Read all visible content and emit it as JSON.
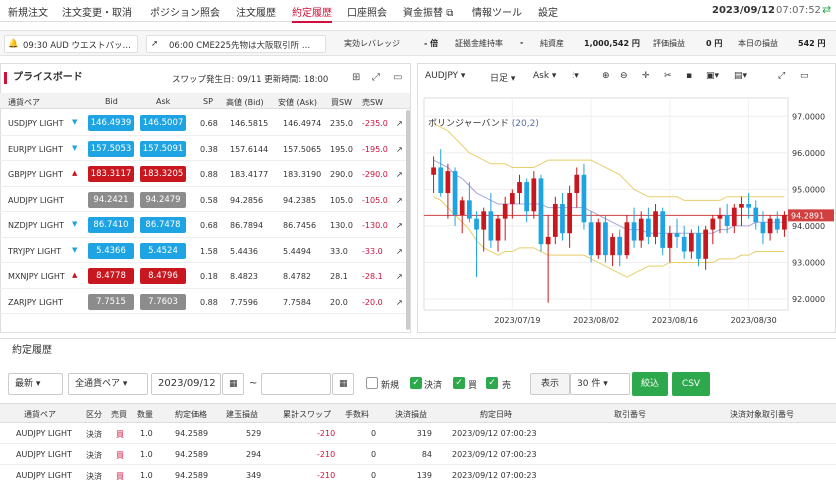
{
  "nav": {
    "items": [
      "新規注文",
      "注文変更・取消",
      "ポジション照会",
      "注文履歴",
      "約定履歴",
      "口座照会",
      "資金振替",
      "情報ツール",
      "設定"
    ],
    "active_index": 4,
    "datetime": "2023/09/12",
    "time": "07:07:52"
  },
  "news": {
    "item1": "09:30 AUD ウエストパッ…",
    "item2": "06:00 CME225先物は大阪取引所 …"
  },
  "account": {
    "leverage_label": "実効レバレッジ",
    "leverage_value": "- 倍",
    "margin_ratio_label": "証拠金維持率",
    "margin_ratio_value": "-",
    "net_assets_label": "純資産",
    "net_assets_value": "1,000,542 円",
    "valuation_label": "評価損益",
    "valuation_value": "0 円",
    "today_pl_label": "本日の損益",
    "today_pl_value": "542 円"
  },
  "priceboard": {
    "title": "プライスボード",
    "swap_info": "スワップ発生日: 09/11 更新時間: 18:00",
    "headers": [
      "通貨ペア",
      "Bid",
      "Ask",
      "SP",
      "高値 (Bid)",
      "安値 (Ask)",
      "買SW",
      "売SW"
    ],
    "rows": [
      {
        "pair": "USDJPY LIGHT",
        "dir": "down",
        "bid": "146.4939",
        "ask": "146.5007",
        "sp": "0.68",
        "high": "146.5815",
        "low": "146.4974",
        "buy_sw": "235.0",
        "sell_sw": "-235.0"
      },
      {
        "pair": "EURJPY LIGHT",
        "dir": "down",
        "bid": "157.5053",
        "ask": "157.5091",
        "sp": "0.38",
        "high": "157.6144",
        "low": "157.5065",
        "buy_sw": "195.0",
        "sell_sw": "-195.0"
      },
      {
        "pair": "GBPJPY LIGHT",
        "dir": "up",
        "bid": "183.3117",
        "ask": "183.3205",
        "sp": "0.88",
        "high": "183.4177",
        "low": "183.3190",
        "buy_sw": "290.0",
        "sell_sw": "-290.0"
      },
      {
        "pair": "AUDJPY LIGHT",
        "dir": "none",
        "bid": "94.2421",
        "ask": "94.2479",
        "sp": "0.58",
        "high": "94.2856",
        "low": "94.2385",
        "buy_sw": "105.0",
        "sell_sw": "-105.0"
      },
      {
        "pair": "NZDJPY LIGHT",
        "dir": "down",
        "bid": "86.7410",
        "ask": "86.7478",
        "sp": "0.68",
        "high": "86.7894",
        "low": "86.7456",
        "buy_sw": "130.0",
        "sell_sw": "-130.0"
      },
      {
        "pair": "TRYJPY LIGHT",
        "dir": "down",
        "bid": "5.4366",
        "ask": "5.4524",
        "sp": "1.58",
        "high": "5.4436",
        "low": "5.4494",
        "buy_sw": "33.0",
        "sell_sw": "-33.0"
      },
      {
        "pair": "MXNJPY LIGHT",
        "dir": "up",
        "bid": "8.4778",
        "ask": "8.4796",
        "sp": "0.18",
        "high": "8.4823",
        "low": "8.4782",
        "buy_sw": "28.1",
        "sell_sw": "-28.1"
      },
      {
        "pair": "ZARJPY LIGHT",
        "dir": "none",
        "bid": "7.7515",
        "ask": "7.7603",
        "sp": "0.88",
        "high": "7.7596",
        "low": "7.7584",
        "buy_sw": "20.0",
        "sell_sw": "-20.0"
      }
    ]
  },
  "chart": {
    "symbol": "AUDJPY",
    "timeframe": "日足",
    "side": "Ask",
    "indicator_label": "ボリンジャーバンド",
    "indicator_params": "(20,2)",
    "current_price_label": "94.2891",
    "colors": {
      "up": "#c8171e",
      "down": "#1ea3e3",
      "band": "#e8cf6a",
      "mid": "#a9a4d8",
      "price": "#d04040"
    }
  },
  "chart_data": {
    "type": "candlestick",
    "yaxis_ticks": [
      "97.0000",
      "96.0000",
      "95.0000",
      "94.0000",
      "93.0000",
      "92.0000"
    ],
    "ylim": [
      91.7,
      97.5
    ],
    "xaxis_ticks": [
      "2023/07/19",
      "2023/08/02",
      "2023/08/16",
      "2023/08/30"
    ],
    "candles": [
      {
        "o": 95.4,
        "h": 95.9,
        "l": 94.9,
        "c": 95.6
      },
      {
        "o": 95.6,
        "h": 96.1,
        "l": 94.8,
        "c": 94.9
      },
      {
        "o": 94.9,
        "h": 95.7,
        "l": 94.2,
        "c": 95.5
      },
      {
        "o": 95.5,
        "h": 95.6,
        "l": 94.0,
        "c": 94.3
      },
      {
        "o": 94.3,
        "h": 94.8,
        "l": 93.8,
        "c": 94.7
      },
      {
        "o": 94.7,
        "h": 95.2,
        "l": 94.1,
        "c": 94.2
      },
      {
        "o": 94.2,
        "h": 94.4,
        "l": 92.6,
        "c": 93.9
      },
      {
        "o": 93.9,
        "h": 94.5,
        "l": 93.3,
        "c": 94.4
      },
      {
        "o": 94.4,
        "h": 94.9,
        "l": 93.4,
        "c": 93.6
      },
      {
        "o": 93.6,
        "h": 94.3,
        "l": 93.3,
        "c": 94.2
      },
      {
        "o": 94.2,
        "h": 94.8,
        "l": 93.6,
        "c": 94.6
      },
      {
        "o": 94.6,
        "h": 95.0,
        "l": 94.2,
        "c": 94.9
      },
      {
        "o": 94.9,
        "h": 95.4,
        "l": 94.6,
        "c": 95.2
      },
      {
        "o": 95.2,
        "h": 95.3,
        "l": 94.1,
        "c": 94.4
      },
      {
        "o": 94.4,
        "h": 95.5,
        "l": 94.2,
        "c": 95.3
      },
      {
        "o": 95.3,
        "h": 95.4,
        "l": 93.3,
        "c": 93.5
      },
      {
        "o": 93.5,
        "h": 94.3,
        "l": 91.9,
        "c": 93.7
      },
      {
        "o": 93.7,
        "h": 94.8,
        "l": 93.5,
        "c": 94.6
      },
      {
        "o": 94.6,
        "h": 94.9,
        "l": 93.6,
        "c": 93.8
      },
      {
        "o": 93.8,
        "h": 95.1,
        "l": 93.4,
        "c": 94.9
      },
      {
        "o": 94.9,
        "h": 95.6,
        "l": 94.5,
        "c": 95.4
      },
      {
        "o": 95.4,
        "h": 95.7,
        "l": 93.9,
        "c": 94.1
      },
      {
        "o": 94.1,
        "h": 94.4,
        "l": 93.0,
        "c": 93.2
      },
      {
        "o": 93.2,
        "h": 94.2,
        "l": 93.1,
        "c": 94.1
      },
      {
        "o": 94.1,
        "h": 94.3,
        "l": 93.0,
        "c": 93.2
      },
      {
        "o": 93.2,
        "h": 93.8,
        "l": 92.9,
        "c": 93.7
      },
      {
        "o": 93.7,
        "h": 93.9,
        "l": 92.9,
        "c": 93.2
      },
      {
        "o": 93.2,
        "h": 94.3,
        "l": 93.1,
        "c": 94.1
      },
      {
        "o": 94.1,
        "h": 94.5,
        "l": 93.4,
        "c": 93.6
      },
      {
        "o": 93.6,
        "h": 94.4,
        "l": 93.4,
        "c": 94.2
      },
      {
        "o": 94.2,
        "h": 94.5,
        "l": 93.5,
        "c": 93.7
      },
      {
        "o": 93.7,
        "h": 94.6,
        "l": 93.5,
        "c": 94.4
      },
      {
        "o": 94.4,
        "h": 94.5,
        "l": 93.2,
        "c": 93.4
      },
      {
        "o": 93.4,
        "h": 94.0,
        "l": 93.0,
        "c": 93.8
      },
      {
        "o": 93.8,
        "h": 94.2,
        "l": 93.4,
        "c": 93.7
      },
      {
        "o": 93.7,
        "h": 94.0,
        "l": 93.1,
        "c": 93.3
      },
      {
        "o": 93.3,
        "h": 93.9,
        "l": 93.1,
        "c": 93.8
      },
      {
        "o": 93.8,
        "h": 94.0,
        "l": 92.9,
        "c": 93.1
      },
      {
        "o": 93.1,
        "h": 94.0,
        "l": 92.8,
        "c": 93.9
      },
      {
        "o": 93.9,
        "h": 94.3,
        "l": 93.5,
        "c": 94.2
      },
      {
        "o": 94.2,
        "h": 94.5,
        "l": 93.8,
        "c": 94.3
      },
      {
        "o": 94.3,
        "h": 94.6,
        "l": 93.8,
        "c": 94.0
      },
      {
        "o": 94.0,
        "h": 94.6,
        "l": 93.8,
        "c": 94.5
      },
      {
        "o": 94.5,
        "h": 94.8,
        "l": 94.0,
        "c": 94.6
      },
      {
        "o": 94.6,
        "h": 94.9,
        "l": 94.2,
        "c": 94.5
      },
      {
        "o": 94.5,
        "h": 94.7,
        "l": 93.9,
        "c": 94.1
      },
      {
        "o": 94.1,
        "h": 94.4,
        "l": 93.5,
        "c": 93.8
      },
      {
        "o": 93.8,
        "h": 94.3,
        "l": 93.6,
        "c": 94.2
      },
      {
        "o": 94.2,
        "h": 94.4,
        "l": 93.8,
        "c": 93.9
      },
      {
        "o": 93.9,
        "h": 94.4,
        "l": 93.7,
        "c": 94.3
      }
    ],
    "upper_band": [
      96.8,
      96.7,
      96.6,
      96.4,
      96.2,
      96.0,
      95.9,
      95.8,
      95.7,
      95.7,
      95.7,
      95.6,
      95.6,
      95.6,
      95.6,
      95.7,
      95.8,
      95.8,
      95.8,
      95.8,
      95.8,
      95.8,
      95.8,
      95.7,
      95.6,
      95.5,
      95.4,
      95.2,
      95.0,
      94.9,
      94.8,
      94.8,
      94.8,
      94.8,
      94.8,
      94.7,
      94.7,
      94.7,
      94.7,
      94.7,
      94.7,
      94.8,
      94.8,
      94.8,
      94.8,
      94.8,
      94.8,
      94.8,
      94.8,
      94.8
    ],
    "middle_band": [
      95.8,
      95.7,
      95.6,
      95.4,
      95.3,
      95.1,
      94.9,
      94.8,
      94.7,
      94.6,
      94.6,
      94.6,
      94.6,
      94.6,
      94.6,
      94.6,
      94.5,
      94.5,
      94.5,
      94.5,
      94.5,
      94.5,
      94.4,
      94.3,
      94.2,
      94.1,
      94.0,
      93.9,
      93.9,
      93.9,
      93.8,
      93.8,
      93.8,
      93.8,
      93.8,
      93.8,
      93.8,
      93.8,
      93.8,
      93.8,
      93.9,
      93.9,
      94.0,
      94.0,
      94.0,
      94.1,
      94.1,
      94.1,
      94.1,
      94.1
    ],
    "lower_band": [
      94.8,
      94.7,
      94.5,
      94.3,
      94.1,
      93.9,
      93.6,
      93.4,
      93.3,
      93.2,
      93.3,
      93.3,
      93.4,
      93.4,
      93.4,
      93.3,
      93.2,
      93.2,
      93.2,
      93.2,
      93.2,
      93.2,
      93.1,
      93.0,
      92.9,
      92.8,
      92.7,
      92.6,
      92.7,
      92.8,
      92.9,
      92.9,
      92.9,
      93.0,
      93.0,
      93.0,
      93.0,
      93.0,
      93.0,
      93.0,
      93.1,
      93.1,
      93.1,
      93.2,
      93.2,
      93.3,
      93.3,
      93.3,
      93.3,
      93.3
    ],
    "current_price": 94.2891
  },
  "history": {
    "title": "約定履歴",
    "filter_sort": "最新",
    "filter_pair": "全通貨ペア",
    "date_from": "2023/09/12",
    "date_sep": "~",
    "date_to": "",
    "checks": [
      {
        "label": "新規",
        "checked": false
      },
      {
        "label": "決済",
        "checked": true
      },
      {
        "label": "買",
        "checked": true
      },
      {
        "label": "売",
        "checked": true
      }
    ],
    "display_label": "表示",
    "display_count": "30 件",
    "filter_button": "絞込",
    "csv_button": "CSV",
    "headers": [
      "通貨ペア",
      "区分",
      "売買",
      "数量",
      "約定価格",
      "建玉損益",
      "累計スワップ",
      "手数料",
      "決済損益",
      "約定日時",
      "取引番号",
      "決済対象取引番号"
    ],
    "rows": [
      {
        "pair": "AUDJPY LIGHT",
        "type": "決済",
        "side": "買",
        "qty": "1.0",
        "price": "94.2589",
        "pos_pl": "529",
        "swap": "-210",
        "fee": "0",
        "pl": "319",
        "datetime": "2023/09/12 07:00:23"
      },
      {
        "pair": "AUDJPY LIGHT",
        "type": "決済",
        "side": "買",
        "qty": "1.0",
        "price": "94.2589",
        "pos_pl": "294",
        "swap": "-210",
        "fee": "0",
        "pl": "84",
        "datetime": "2023/09/12 07:00:23"
      },
      {
        "pair": "AUDJPY LIGHT",
        "type": "決済",
        "side": "買",
        "qty": "1.0",
        "price": "94.2589",
        "pos_pl": "349",
        "swap": "-210",
        "fee": "0",
        "pl": "139",
        "datetime": "2023/09/12 07:00:23"
      }
    ]
  }
}
